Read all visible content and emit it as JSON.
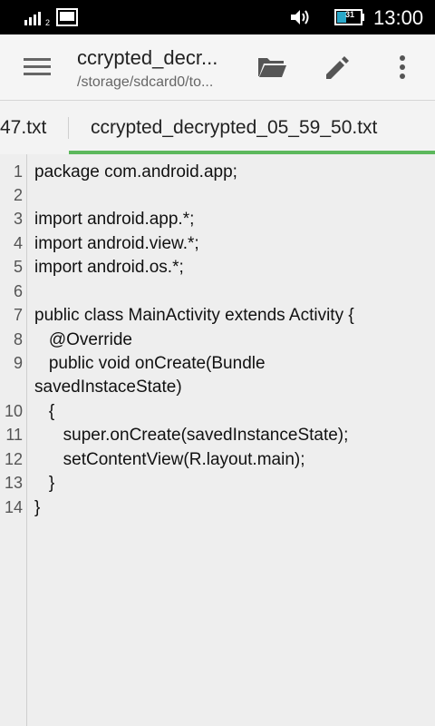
{
  "status_bar": {
    "signal_icon": "signal-strength-icon",
    "signal_label": "2",
    "screen_icon": "screenshot-icon",
    "volume_icon": "volume-icon",
    "battery_icon": "battery-icon",
    "battery_level": "31",
    "time": "13:00"
  },
  "toolbar": {
    "menu_icon": "hamburger-menu-icon",
    "title": "ccrypted_decr...",
    "subtitle": "/storage/sdcard0/to...",
    "folder_icon": "folder-open-icon",
    "edit_icon": "pencil-icon",
    "more_icon": "more-vert-icon"
  },
  "tabs": {
    "items": [
      {
        "label": "47.txt",
        "active": false
      },
      {
        "label": "ccrypted_decrypted_05_59_50.txt",
        "active": true
      }
    ],
    "accent_color": "#5cb85c"
  },
  "editor": {
    "line_numbers": [
      "1",
      "2",
      "3",
      "4",
      "5",
      "6",
      "7",
      "8",
      "9",
      "10",
      "11",
      "12",
      "13",
      "14"
    ],
    "lines": [
      "package com.android.app;",
      "",
      "import android.app.*;",
      "import android.view.*;",
      "import android.os.*;",
      "",
      "public class MainActivity extends Activity {",
      "   @Override",
      "   public void onCreate(Bundle",
      "savedInstaceState)",
      "   {",
      "      super.onCreate(savedInstanceState);",
      "      setContentView(R.layout.main);",
      "   }",
      "}"
    ]
  }
}
